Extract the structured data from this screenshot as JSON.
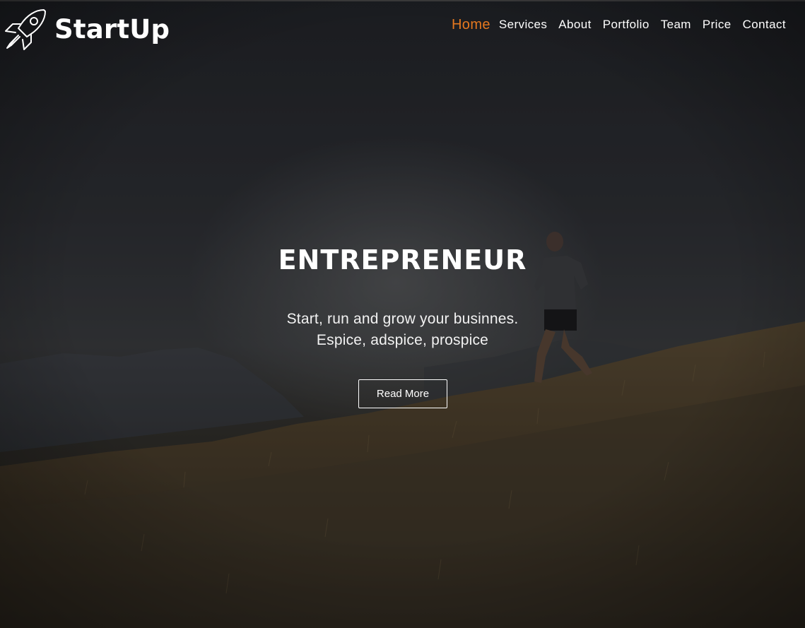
{
  "brand": {
    "name": "StartUp",
    "icon": "rocket-icon"
  },
  "nav": {
    "items": [
      "Home",
      "Services",
      "About",
      "Portfolio",
      "Team",
      "Price",
      "Contact"
    ],
    "active": "Home"
  },
  "hero": {
    "title": "ENTREPRENEUR",
    "subtitle_line1": "Start, run and grow your businnes.",
    "subtitle_line2": "Espice, adspice, prospice",
    "button_label": "Read More"
  },
  "colors": {
    "accent": "#e5781f",
    "text": "#ffffff",
    "overlay": "#1d1f23"
  }
}
